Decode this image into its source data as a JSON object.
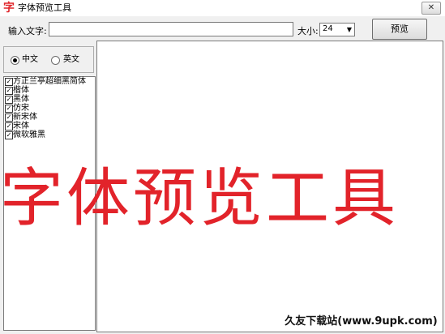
{
  "window": {
    "app_icon_glyph": "字",
    "title": "字体预览工具",
    "close_glyph": "✕"
  },
  "toolbar": {
    "input_label": "输入文字:",
    "input_value": "",
    "size_label": "大小:",
    "size_value": "24",
    "preview_button": "预览"
  },
  "language": {
    "chinese": "中文",
    "english": "英文",
    "selected": "中文"
  },
  "fonts": [
    {
      "name": "方正兰亭超细黑简体",
      "checked": true
    },
    {
      "name": "楷体",
      "checked": true
    },
    {
      "name": "黑体",
      "checked": true
    },
    {
      "name": "仿宋",
      "checked": true
    },
    {
      "name": "新宋体",
      "checked": true
    },
    {
      "name": "宋体",
      "checked": true
    },
    {
      "name": "微软雅黑",
      "checked": true
    }
  ],
  "preview": {
    "text": "字体预览工具",
    "color": "#e2232a"
  },
  "watermark": "久友下载站(www.9upk.com)"
}
